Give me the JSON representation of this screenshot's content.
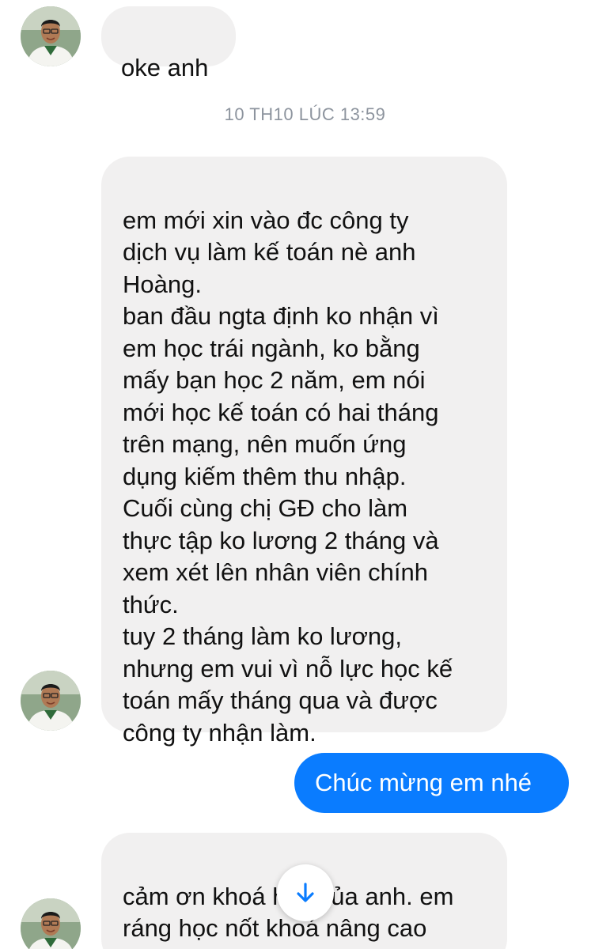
{
  "conversation": {
    "messages": [
      {
        "sender": "contact",
        "text": "oke anh"
      },
      {
        "sender": "contact",
        "text": "em mới xin vào đc công ty\ndịch vụ làm kế toán nè anh\nHoàng.\nban đầu ngta định ko nhận vì\nem học trái ngành, ko bằng\nmấy bạn học 2 năm, em nói\nmới học kế toán có hai tháng\ntrên mạng, nên muốn ứng\ndụng kiếm thêm thu nhập.\nCuối cùng chị GĐ cho làm\nthực tập ko lương 2 tháng và\nxem xét lên nhân viên chính\nthức.\ntuy 2 tháng làm ko lương,\nnhưng em vui vì nỗ lực học kế\ntoán mấy tháng qua và được\ncông ty nhận làm."
      },
      {
        "sender": "me",
        "text": "Chúc mừng em nhé"
      },
      {
        "sender": "contact",
        "text": "cảm ơn khoá học của anh. em\nráng học nốt khoá nâng cao\nkiến thức và thực hành."
      }
    ],
    "timestamp": "10 TH10 LÚC 13:59"
  },
  "icons": {
    "avatar": "contact-avatar-photo",
    "scroll_down": "arrow-down-icon"
  },
  "colors": {
    "incoming_bubble": "#f1f0f0",
    "outgoing_bubble": "#0a7cff",
    "timestamp_text": "#8d949e",
    "scroll_arrow": "#0a7cff"
  }
}
